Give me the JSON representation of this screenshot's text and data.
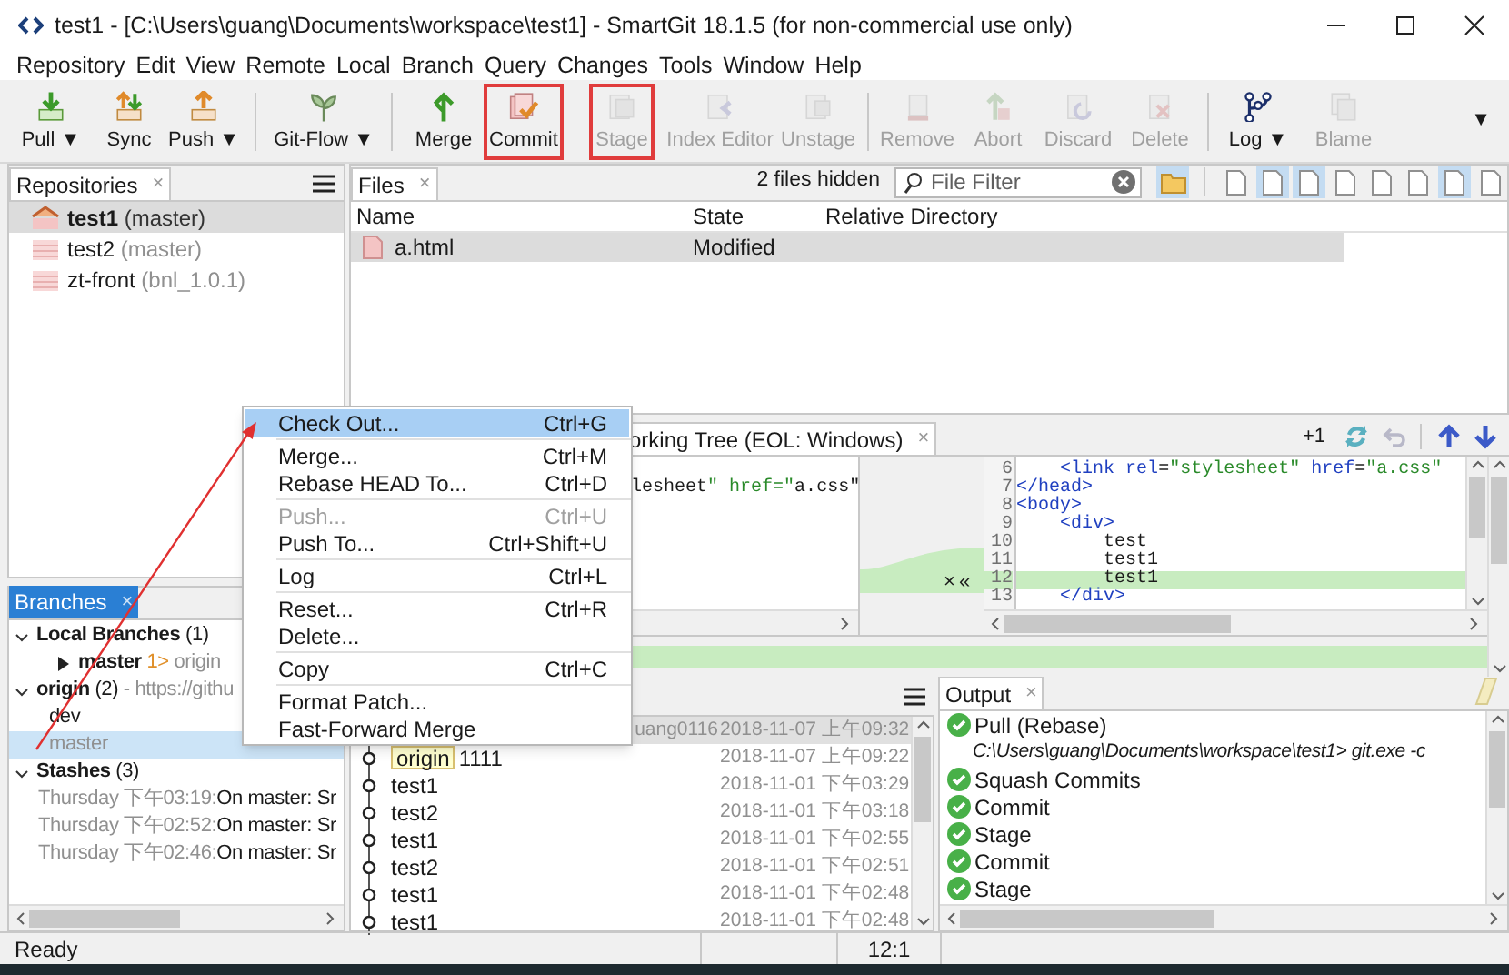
{
  "window": {
    "title": "test1 - [C:\\Users\\guang\\Documents\\workspace\\test1] - SmartGit 18.1.5 (for non-commercial use only)"
  },
  "menu": [
    "Repository",
    "Edit",
    "View",
    "Remote",
    "Local",
    "Branch",
    "Query",
    "Changes",
    "Tools",
    "Window",
    "Help"
  ],
  "toolbar": [
    {
      "kind": "button",
      "label": "Pull ▼",
      "disabled": false,
      "annotated": false
    },
    {
      "kind": "button",
      "label": "Sync",
      "disabled": false,
      "annotated": false
    },
    {
      "kind": "button",
      "label": "Push ▼",
      "disabled": false,
      "annotated": false
    },
    {
      "kind": "separator"
    },
    {
      "kind": "button",
      "label": "Git-Flow ▼",
      "disabled": false,
      "annotated": false
    },
    {
      "kind": "separator"
    },
    {
      "kind": "button",
      "label": "Merge",
      "disabled": false,
      "annotated": false
    },
    {
      "kind": "button",
      "label": "Commit",
      "disabled": false,
      "annotated": true
    },
    {
      "kind": "button",
      "label": "Stage",
      "disabled": true,
      "annotated": true
    },
    {
      "kind": "button",
      "label": "Index Editor",
      "disabled": true,
      "annotated": false
    },
    {
      "kind": "button",
      "label": "Unstage",
      "disabled": true,
      "annotated": false
    },
    {
      "kind": "separator"
    },
    {
      "kind": "button",
      "label": "Remove",
      "disabled": true,
      "annotated": false
    },
    {
      "kind": "button",
      "label": "Abort",
      "disabled": true,
      "annotated": false
    },
    {
      "kind": "button",
      "label": "Discard",
      "disabled": true,
      "annotated": false
    },
    {
      "kind": "button",
      "label": "Delete",
      "disabled": true,
      "annotated": false
    },
    {
      "kind": "separator"
    },
    {
      "kind": "button",
      "label": "Log ▼",
      "disabled": false,
      "annotated": false
    },
    {
      "kind": "button",
      "label": "Blame",
      "disabled": true,
      "annotated": false
    }
  ],
  "toolbar_overflow": "▼",
  "repositories": {
    "tab": "Repositories",
    "close": "×",
    "items": [
      {
        "name": "test1",
        "branch": "(master)",
        "selected": true
      },
      {
        "name": "test2",
        "branch": "(master)",
        "selected": false
      },
      {
        "name": "zt-front",
        "branch": "(bnl_1.0.1)",
        "selected": false
      }
    ]
  },
  "files": {
    "tab": "Files",
    "close": "×",
    "hidden": "2 files hidden",
    "filter": {
      "placeholder": "File Filter"
    },
    "folder_toggle": {
      "on": true
    },
    "view_toggles": [
      {
        "on": false
      },
      {
        "on": true
      },
      {
        "on": true
      },
      {
        "on": false
      },
      {
        "on": false
      },
      {
        "on": false
      },
      {
        "on": true
      },
      {
        "on": false
      }
    ],
    "columns": [
      "Name",
      "State",
      "Relative Directory"
    ],
    "rows": [
      {
        "name": "a.html",
        "state": "Modified",
        "selected": true
      }
    ]
  },
  "diff": {
    "tab": "orking Tree (EOL: Windows)",
    "close": "×",
    "change_count": "+1",
    "left_lines": [
      {
        "code": "lesheet\" href=\"a.css\""
      }
    ],
    "gutter_actions": [
      "×",
      "«"
    ],
    "right_lines": [
      {
        "number": "6",
        "code": "    <link rel=\"stylesheet\" href=\"a.css\"",
        "changed": false
      },
      {
        "number": "7",
        "code": "</head>",
        "changed": false
      },
      {
        "number": "8",
        "code": "<body>",
        "changed": false
      },
      {
        "number": "9",
        "code": "    <div>",
        "changed": false
      },
      {
        "number": "10",
        "code": "        test",
        "changed": false
      },
      {
        "number": "11",
        "code": "        test1",
        "changed": false
      },
      {
        "number": "12",
        "code": "        test1",
        "changed": true
      },
      {
        "number": "13",
        "code": "    </div>",
        "changed": false
      }
    ]
  },
  "branches": {
    "tab": "Branches",
    "close": "×",
    "tree": [
      {
        "kind": "group",
        "label": "Local Branches",
        "count": "(1)",
        "expanded": true,
        "children": [
          {
            "kind": "branch",
            "label": "master",
            "ahead": "1>",
            "tracking": "origin",
            "expanded": false,
            "selected": false
          }
        ]
      },
      {
        "kind": "group",
        "label": "origin",
        "count": "(2)",
        "detail": "- https://githu",
        "expanded": true,
        "children": [
          {
            "kind": "remote",
            "label": "dev",
            "selected": false
          },
          {
            "kind": "remote",
            "label": "master",
            "selected": true
          }
        ]
      },
      {
        "kind": "group",
        "label": "Stashes",
        "count": "(3)",
        "expanded": true,
        "children": [
          {
            "kind": "stash",
            "time": "Thursday 下午03:19:",
            "message": "On master: Sr"
          },
          {
            "kind": "stash",
            "time": "Thursday 下午02:52:",
            "message": "On master: Sr"
          },
          {
            "kind": "stash",
            "time": "Thursday 下午02:46:",
            "message": "On master: Sr"
          }
        ]
      }
    ]
  },
  "log": {
    "rows": [
      {
        "author": "uang0116",
        "date": "2018-11-07 上午09:32",
        "selected": true
      },
      {
        "tag": "origin",
        "message": "1111",
        "date": "2018-11-07 上午09:22",
        "selected": false
      },
      {
        "message": "test1",
        "date": "2018-11-01 下午03:29",
        "selected": false
      },
      {
        "message": "test2",
        "date": "2018-11-01 下午03:18",
        "selected": false
      },
      {
        "message": "test1",
        "date": "2018-11-01 下午02:55",
        "selected": false
      },
      {
        "message": "test2",
        "date": "2018-11-01 下午02:51",
        "selected": false
      },
      {
        "message": "test1",
        "date": "2018-11-01 下午02:48",
        "selected": false
      },
      {
        "message": "test1",
        "date": "2018-11-01 下午02:48",
        "selected": false
      }
    ]
  },
  "output": {
    "tab": "Output",
    "close": "×",
    "items": [
      {
        "kind": "success",
        "text": "Pull (Rebase)"
      },
      {
        "kind": "command",
        "text": "C:\\Users\\guang\\Documents\\workspace\\test1> git.exe -c"
      },
      {
        "kind": "success",
        "text": "Squash Commits"
      },
      {
        "kind": "success",
        "text": "Commit"
      },
      {
        "kind": "success",
        "text": "Stage"
      },
      {
        "kind": "success",
        "text": "Commit"
      },
      {
        "kind": "success",
        "text": "Stage"
      }
    ]
  },
  "context_menu": [
    {
      "kind": "item",
      "label": "Check Out...",
      "shortcut": "Ctrl+G",
      "selected": true,
      "disabled": false
    },
    {
      "kind": "separator"
    },
    {
      "kind": "item",
      "label": "Merge...",
      "shortcut": "Ctrl+M",
      "selected": false,
      "disabled": false
    },
    {
      "kind": "item",
      "label": "Rebase HEAD To...",
      "shortcut": "Ctrl+D",
      "selected": false,
      "disabled": false
    },
    {
      "kind": "separator"
    },
    {
      "kind": "item",
      "label": "Push...",
      "shortcut": "Ctrl+U",
      "selected": false,
      "disabled": true
    },
    {
      "kind": "item",
      "label": "Push To...",
      "shortcut": "Ctrl+Shift+U",
      "selected": false,
      "disabled": false
    },
    {
      "kind": "separator"
    },
    {
      "kind": "item",
      "label": "Log",
      "shortcut": "Ctrl+L",
      "selected": false,
      "disabled": false
    },
    {
      "kind": "separator"
    },
    {
      "kind": "item",
      "label": "Reset...",
      "shortcut": "Ctrl+R",
      "selected": false,
      "disabled": false
    },
    {
      "kind": "item",
      "label": "Delete...",
      "selected": false,
      "disabled": false
    },
    {
      "kind": "separator"
    },
    {
      "kind": "item",
      "label": "Copy",
      "shortcut": "Ctrl+C",
      "selected": false,
      "disabled": false
    },
    {
      "kind": "separator"
    },
    {
      "kind": "item",
      "label": "Format Patch...",
      "selected": false,
      "disabled": false
    },
    {
      "kind": "item",
      "label": "Fast-Forward Merge",
      "selected": false,
      "disabled": false
    }
  ],
  "annotation_arrow": true,
  "status_bar": {
    "message": "Ready",
    "position": "12:1"
  }
}
